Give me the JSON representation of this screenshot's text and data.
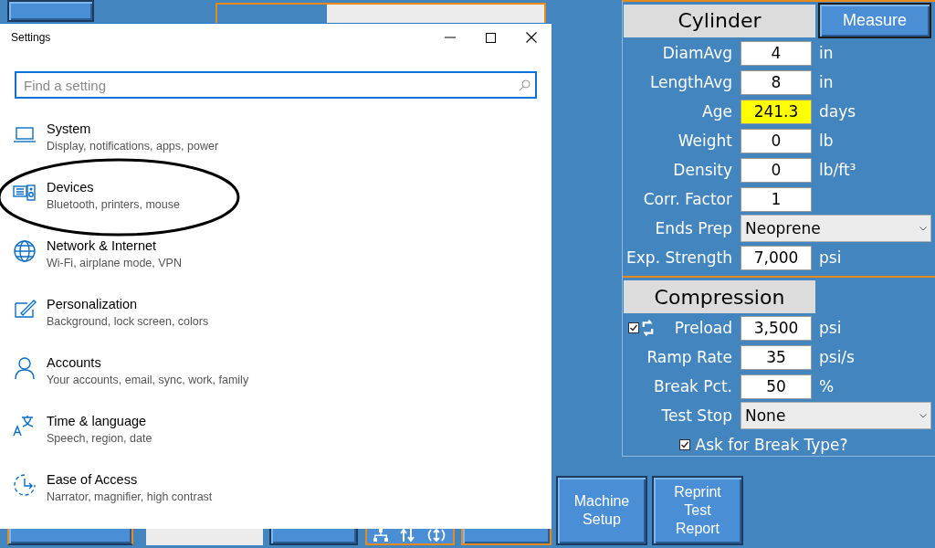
{
  "background_app": {
    "cylinder": {
      "title": "Cylinder",
      "measure_button": "Measure",
      "fields": [
        {
          "kind": "input",
          "label": "DiamAvg",
          "value": "4",
          "unit": "in",
          "highlighted": false
        },
        {
          "kind": "input",
          "label": "LengthAvg",
          "value": "8",
          "unit": "in",
          "highlighted": false
        },
        {
          "kind": "input",
          "label": "Age",
          "value": "241.3",
          "unit": "days",
          "highlighted": true
        },
        {
          "kind": "input",
          "label": "Weight",
          "value": "0",
          "unit": "lb",
          "highlighted": false
        },
        {
          "kind": "input",
          "label": "Density",
          "value": "0",
          "unit": "lb/ft³",
          "highlighted": false
        },
        {
          "kind": "input",
          "label": "Corr. Factor",
          "value": "1",
          "highlighted": false
        },
        {
          "kind": "select",
          "label": "Ends Prep",
          "value": "Neoprene"
        },
        {
          "kind": "input",
          "label": "Exp. Strength",
          "value": "7,000",
          "unit": "psi",
          "highlighted": false
        }
      ]
    },
    "compression": {
      "title": "Compression",
      "fields": [
        {
          "kind": "checked_input",
          "checked": true,
          "label": "Preload",
          "value": "3,500",
          "unit": "psi",
          "highlighted": false
        },
        {
          "kind": "input",
          "label": "Ramp Rate",
          "value": "35",
          "unit": "psi/s",
          "highlighted": false
        },
        {
          "kind": "input",
          "label": "Break Pct.",
          "value": "50",
          "unit": "%",
          "highlighted": false
        },
        {
          "kind": "select",
          "label": "Test Stop",
          "value": "None"
        }
      ],
      "ask_break_type": {
        "label": "Ask for Break Type?",
        "checked": true
      }
    },
    "bottom_bar": {
      "machine_setup": "Machine\nSetup",
      "reprint": "Reprint\nTest\nReport"
    }
  },
  "settings_window": {
    "title": "Settings",
    "search": {
      "placeholder": "Find a setting"
    },
    "items": [
      {
        "kind": "laptop",
        "title": "System",
        "subtitle": "Display, notifications, apps, power",
        "circled": false
      },
      {
        "kind": "devices",
        "title": "Devices",
        "subtitle": "Bluetooth, printers, mouse",
        "circled": true
      },
      {
        "kind": "globe",
        "title": "Network & Internet",
        "subtitle": "Wi-Fi, airplane mode, VPN",
        "circled": false
      },
      {
        "kind": "brush",
        "title": "Personalization",
        "subtitle": "Background, lock screen, colors",
        "circled": false
      },
      {
        "kind": "person",
        "title": "Accounts",
        "subtitle": "Your accounts, email, sync, work, family",
        "circled": false
      },
      {
        "kind": "language",
        "title": "Time & language",
        "subtitle": "Speech, region, date",
        "circled": false
      },
      {
        "kind": "ease",
        "title": "Ease of Access",
        "subtitle": "Narrator, magnifier, high contrast",
        "circled": false
      }
    ]
  }
}
